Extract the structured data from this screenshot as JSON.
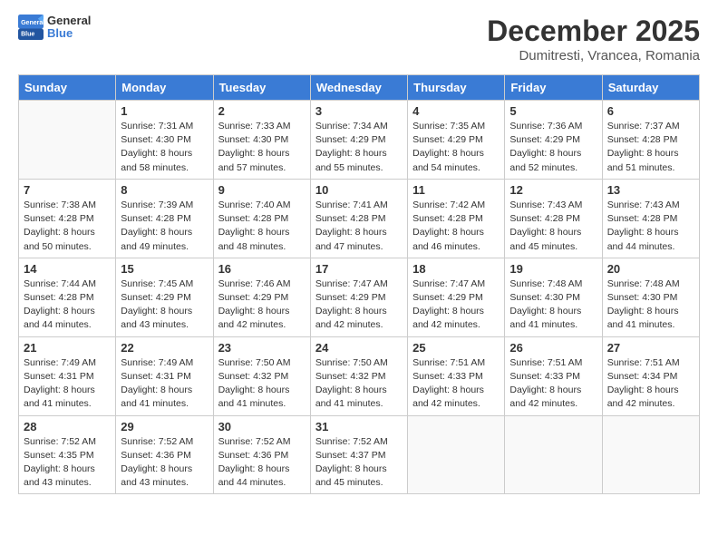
{
  "logo": {
    "general": "General",
    "blue": "Blue"
  },
  "header": {
    "title": "December 2025",
    "subtitle": "Dumitresti, Vrancea, Romania"
  },
  "weekdays": [
    "Sunday",
    "Monday",
    "Tuesday",
    "Wednesday",
    "Thursday",
    "Friday",
    "Saturday"
  ],
  "weeks": [
    [
      {
        "day": "",
        "info": ""
      },
      {
        "day": "1",
        "info": "Sunrise: 7:31 AM\nSunset: 4:30 PM\nDaylight: 8 hours\nand 58 minutes."
      },
      {
        "day": "2",
        "info": "Sunrise: 7:33 AM\nSunset: 4:30 PM\nDaylight: 8 hours\nand 57 minutes."
      },
      {
        "day": "3",
        "info": "Sunrise: 7:34 AM\nSunset: 4:29 PM\nDaylight: 8 hours\nand 55 minutes."
      },
      {
        "day": "4",
        "info": "Sunrise: 7:35 AM\nSunset: 4:29 PM\nDaylight: 8 hours\nand 54 minutes."
      },
      {
        "day": "5",
        "info": "Sunrise: 7:36 AM\nSunset: 4:29 PM\nDaylight: 8 hours\nand 52 minutes."
      },
      {
        "day": "6",
        "info": "Sunrise: 7:37 AM\nSunset: 4:28 PM\nDaylight: 8 hours\nand 51 minutes."
      }
    ],
    [
      {
        "day": "7",
        "info": "Sunrise: 7:38 AM\nSunset: 4:28 PM\nDaylight: 8 hours\nand 50 minutes."
      },
      {
        "day": "8",
        "info": "Sunrise: 7:39 AM\nSunset: 4:28 PM\nDaylight: 8 hours\nand 49 minutes."
      },
      {
        "day": "9",
        "info": "Sunrise: 7:40 AM\nSunset: 4:28 PM\nDaylight: 8 hours\nand 48 minutes."
      },
      {
        "day": "10",
        "info": "Sunrise: 7:41 AM\nSunset: 4:28 PM\nDaylight: 8 hours\nand 47 minutes."
      },
      {
        "day": "11",
        "info": "Sunrise: 7:42 AM\nSunset: 4:28 PM\nDaylight: 8 hours\nand 46 minutes."
      },
      {
        "day": "12",
        "info": "Sunrise: 7:43 AM\nSunset: 4:28 PM\nDaylight: 8 hours\nand 45 minutes."
      },
      {
        "day": "13",
        "info": "Sunrise: 7:43 AM\nSunset: 4:28 PM\nDaylight: 8 hours\nand 44 minutes."
      }
    ],
    [
      {
        "day": "14",
        "info": "Sunrise: 7:44 AM\nSunset: 4:28 PM\nDaylight: 8 hours\nand 44 minutes."
      },
      {
        "day": "15",
        "info": "Sunrise: 7:45 AM\nSunset: 4:29 PM\nDaylight: 8 hours\nand 43 minutes."
      },
      {
        "day": "16",
        "info": "Sunrise: 7:46 AM\nSunset: 4:29 PM\nDaylight: 8 hours\nand 42 minutes."
      },
      {
        "day": "17",
        "info": "Sunrise: 7:47 AM\nSunset: 4:29 PM\nDaylight: 8 hours\nand 42 minutes."
      },
      {
        "day": "18",
        "info": "Sunrise: 7:47 AM\nSunset: 4:29 PM\nDaylight: 8 hours\nand 42 minutes."
      },
      {
        "day": "19",
        "info": "Sunrise: 7:48 AM\nSunset: 4:30 PM\nDaylight: 8 hours\nand 41 minutes."
      },
      {
        "day": "20",
        "info": "Sunrise: 7:48 AM\nSunset: 4:30 PM\nDaylight: 8 hours\nand 41 minutes."
      }
    ],
    [
      {
        "day": "21",
        "info": "Sunrise: 7:49 AM\nSunset: 4:31 PM\nDaylight: 8 hours\nand 41 minutes."
      },
      {
        "day": "22",
        "info": "Sunrise: 7:49 AM\nSunset: 4:31 PM\nDaylight: 8 hours\nand 41 minutes."
      },
      {
        "day": "23",
        "info": "Sunrise: 7:50 AM\nSunset: 4:32 PM\nDaylight: 8 hours\nand 41 minutes."
      },
      {
        "day": "24",
        "info": "Sunrise: 7:50 AM\nSunset: 4:32 PM\nDaylight: 8 hours\nand 41 minutes."
      },
      {
        "day": "25",
        "info": "Sunrise: 7:51 AM\nSunset: 4:33 PM\nDaylight: 8 hours\nand 42 minutes."
      },
      {
        "day": "26",
        "info": "Sunrise: 7:51 AM\nSunset: 4:33 PM\nDaylight: 8 hours\nand 42 minutes."
      },
      {
        "day": "27",
        "info": "Sunrise: 7:51 AM\nSunset: 4:34 PM\nDaylight: 8 hours\nand 42 minutes."
      }
    ],
    [
      {
        "day": "28",
        "info": "Sunrise: 7:52 AM\nSunset: 4:35 PM\nDaylight: 8 hours\nand 43 minutes."
      },
      {
        "day": "29",
        "info": "Sunrise: 7:52 AM\nSunset: 4:36 PM\nDaylight: 8 hours\nand 43 minutes."
      },
      {
        "day": "30",
        "info": "Sunrise: 7:52 AM\nSunset: 4:36 PM\nDaylight: 8 hours\nand 44 minutes."
      },
      {
        "day": "31",
        "info": "Sunrise: 7:52 AM\nSunset: 4:37 PM\nDaylight: 8 hours\nand 45 minutes."
      },
      {
        "day": "",
        "info": ""
      },
      {
        "day": "",
        "info": ""
      },
      {
        "day": "",
        "info": ""
      }
    ]
  ]
}
